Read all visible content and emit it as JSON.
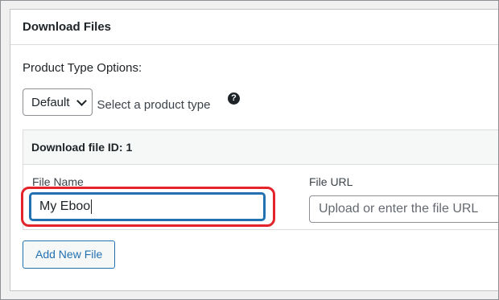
{
  "metabox": {
    "title": "Download Files"
  },
  "product_type": {
    "section_label": "Product Type Options:",
    "selected": "Default",
    "description": "Select a product type",
    "help_glyph": "?"
  },
  "file": {
    "header": "Download file ID: 1",
    "name_label": "File Name",
    "name_value": "My Eboo",
    "url_label": "File URL",
    "url_placeholder": "Upload or enter the file URL"
  },
  "actions": {
    "add_file_label": "Add New File"
  },
  "colors": {
    "accent": "#2271b1",
    "highlight": "#e5232a"
  },
  "icons": {
    "help": "help-icon",
    "dropdown": "chevron-down-icon"
  }
}
